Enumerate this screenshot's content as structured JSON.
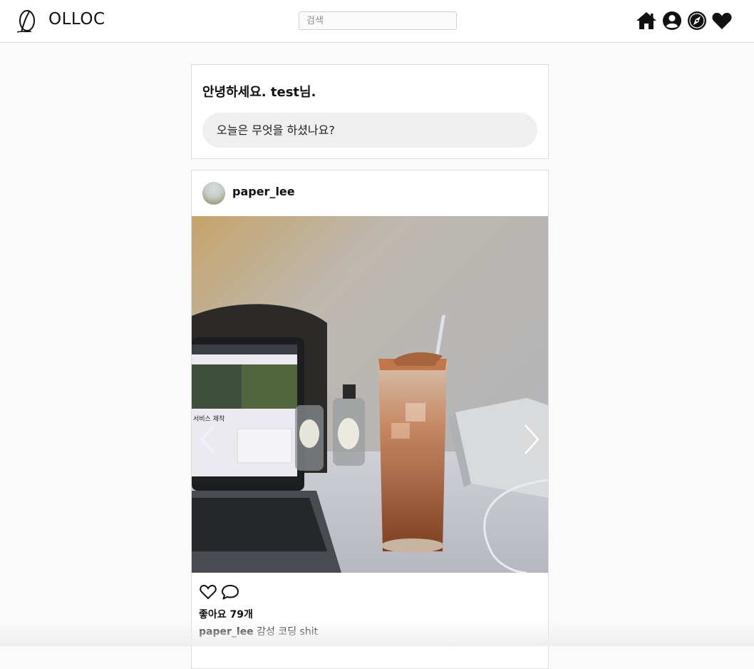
{
  "header": {
    "brand": "OLLOC",
    "search_placeholder": "검색",
    "nav": [
      "home-icon",
      "profile-icon",
      "explore-compass-icon",
      "activity-heart-icon"
    ]
  },
  "greeting": {
    "title": "안녕하세요. test님.",
    "compose_prompt": "오늘은 무엇을 하셨나요?"
  },
  "post": {
    "username": "paper_lee",
    "image_text": "서비스 제작",
    "carousel": {
      "count": 2,
      "active": 1
    },
    "likes_label": "좋아요 79개",
    "caption_user": "paper_lee",
    "caption_text": "감성 코딩 shit",
    "comment_user": "",
    "comment_text": ""
  },
  "colors": {
    "border": "#dbdbdb",
    "background": "#fafafa",
    "compose_bg": "#efefef"
  }
}
